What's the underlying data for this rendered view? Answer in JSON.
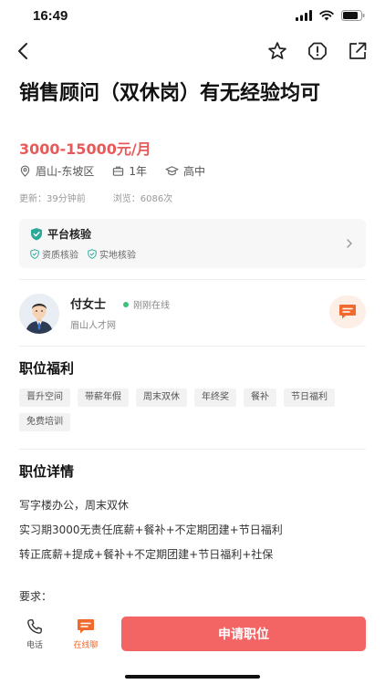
{
  "status_bar": {
    "time": "16:49"
  },
  "job": {
    "title": "销售顾问（双休岗）有无经验均可",
    "salary": "3000-15000元/月",
    "location": "眉山-东坡区",
    "experience": "1年",
    "education": "高中",
    "updated": "更新：39分钟前",
    "views": "浏览：6086次"
  },
  "verify": {
    "title": "平台核验",
    "tags": [
      "资质核验",
      "实地核验"
    ]
  },
  "recruiter": {
    "name": "付女士",
    "status": "刚刚在线",
    "company": "眉山人才网"
  },
  "benefits": {
    "title": "职位福利",
    "items": [
      "晋升空间",
      "带薪年假",
      "周末双休",
      "年终奖",
      "餐补",
      "节日福利",
      "免费培训"
    ]
  },
  "details": {
    "title": "职位详情",
    "lines": [
      "写字楼办公，周末双休",
      "实习期3000无责任底薪+餐补+不定期团建+节日福利",
      "转正底薪+提成+餐补+不定期团建+节日福利+社保"
    ],
    "requirements": "要求："
  },
  "bottom_bar": {
    "phone_label": "电话",
    "chat_label": "在线聊",
    "apply_label": "申请职位"
  },
  "colors": {
    "accent": "#f36565",
    "salary": "#e85a5a",
    "chat_orange": "#f06a2f",
    "verify_green": "#2aa89a",
    "online_green": "#3cc07a"
  }
}
